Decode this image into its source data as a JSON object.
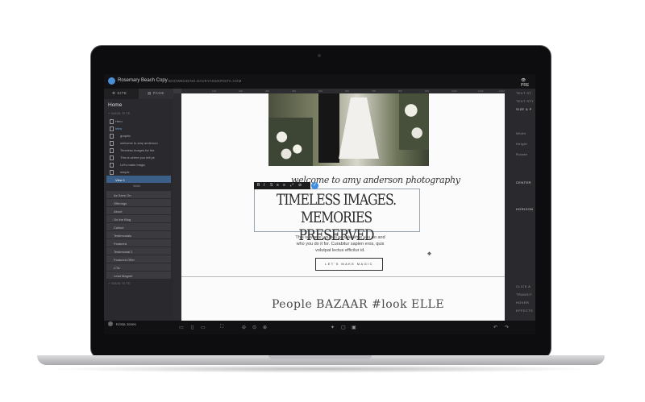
{
  "app": {
    "site_title": "Rosemary Beach Copy",
    "site_url": "BOOWEDDING.DAVEYANDKRISTA.COM",
    "preview_label": "PRE"
  },
  "left_panel": {
    "tabs": [
      {
        "icon": "gear-icon",
        "label": "SITE"
      },
      {
        "icon": "page-icon",
        "label": "PAGE"
      }
    ],
    "page_name": "Home",
    "section_header_1": "MAIN SITE",
    "layers": [
      "Hero",
      "Intro",
      "graphic",
      "welcome to amy anderson",
      "Timeless Images for the",
      "This is where you tell pe",
      "Let's make magic",
      "simple"
    ],
    "selected_view": "View 1",
    "width_label": "Width",
    "blocks": [
      "As Seen On",
      "Offerings",
      "About",
      "On the Blog",
      "Callout",
      "Testimonials",
      "Featured",
      "Testimonial 2",
      "Featured Offer",
      "CTA",
      "Lead Magnet"
    ],
    "section_header_2": "MAIN SITE",
    "user_name": "Krista Jones"
  },
  "ruler": [
    "100",
    "200",
    "300",
    "400",
    "500",
    "600",
    "700",
    "800",
    "900",
    "1000",
    "1100",
    "1200"
  ],
  "canvas": {
    "script_line": "welcome to amy anderson photography",
    "headline_line1": "TIMELESS IMAGES.",
    "headline_line2": "MEMORIES PRESERVED",
    "body_text": "This is where you tell people what you do and who you do it for. Curabitur sapien eros, quis volutpat lectus efficitur id.",
    "cta_label": "LET'S MAKE MAGIC",
    "press_logos": "People   BAZAAR   #look   ELLE",
    "toolbar": [
      "B",
      "I",
      "S",
      "≡",
      "≡",
      "⤢",
      "⊘",
      "✓"
    ]
  },
  "right_panel": [
    "TEXT ST",
    "TEXT STY",
    "SIZE & P",
    "Width",
    "Height",
    "Rotate",
    "CENTER",
    "HORIZON",
    "CLICK A",
    "TRANSIT",
    "HOVER",
    "EFFECTS"
  ],
  "bottom_bar": {
    "icons": [
      "desktop-icon",
      "phone-icon",
      "tablet-icon",
      "expand-icon",
      "zoom-out-icon",
      "zoom-reset-icon",
      "zoom-in-icon",
      "magic-icon",
      "frame-icon",
      "image-icon",
      "undo-icon",
      "redo-icon"
    ]
  },
  "colors": {
    "accent": "#3d8ee0",
    "panel": "#2a2a2e",
    "page": "#fbfbfb"
  }
}
